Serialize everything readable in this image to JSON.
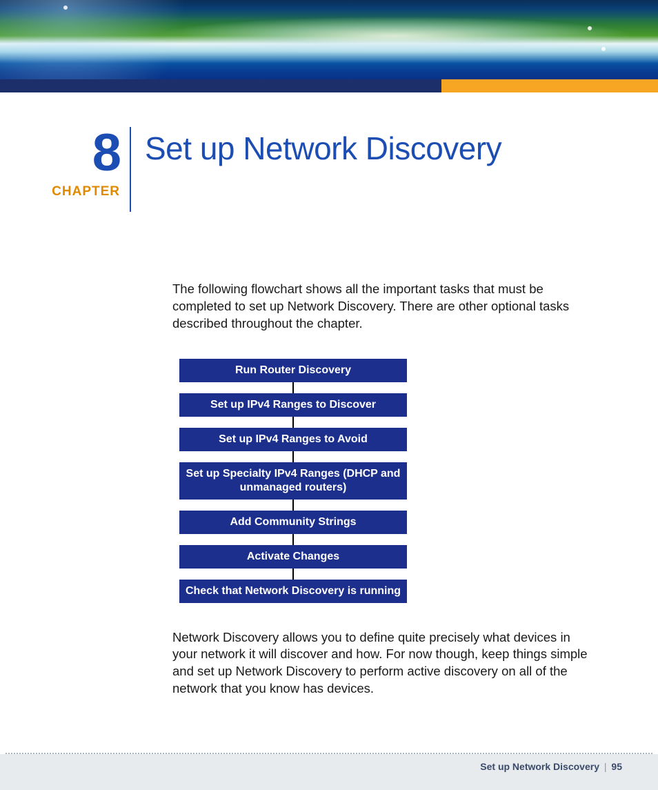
{
  "chapter": {
    "number": "8",
    "label": "CHAPTER",
    "title": "Set up Network Discovery"
  },
  "intro": "The following flowchart shows all the important tasks that must be completed to set up Network Discovery. There are other optional tasks described throughout the chapter.",
  "flow": {
    "steps": [
      "Run Router Discovery",
      "Set up IPv4 Ranges to Discover",
      "Set up IPv4 Ranges to Avoid",
      "Set up Specialty IPv4 Ranges (DHCP and unmanaged routers)",
      "Add Community Strings",
      "Activate Changes",
      "Check that Network Discovery is running"
    ]
  },
  "outro": "Network Discovery allows you to define quite precisely what devices in your network it will discover and how. For now though, keep things simple and set up Network Discovery to perform active discovery on all of the network that you know has devices.",
  "footer": {
    "title": "Set up Network Discovery",
    "separator": "|",
    "page": "95"
  }
}
